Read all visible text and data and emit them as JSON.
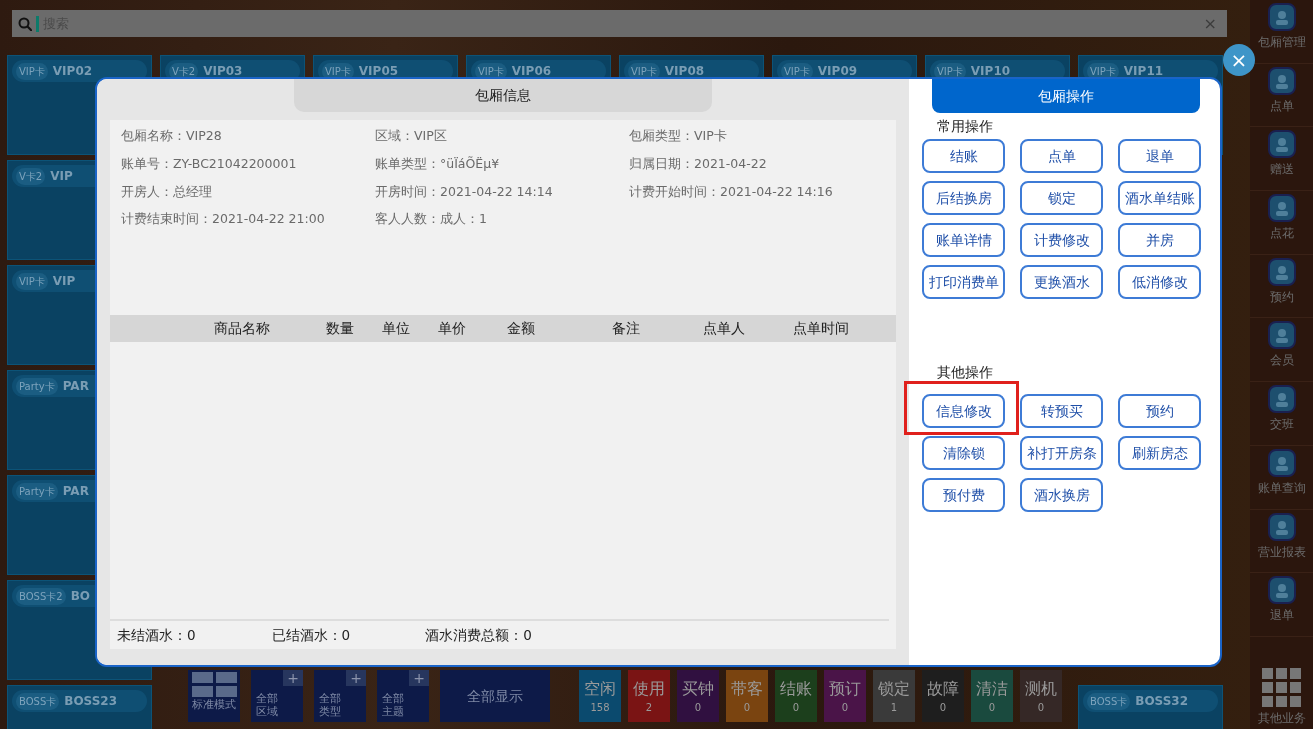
{
  "search": {
    "placeholder": "搜索",
    "clear": "×"
  },
  "rooms": [
    [
      {
        "tag": "VIP卡",
        "name": "VIP02"
      },
      {
        "tag": "V卡2",
        "name": "VIP03"
      },
      {
        "tag": "VIP卡",
        "name": "VIP05"
      },
      {
        "tag": "VIP卡",
        "name": "VIP06"
      },
      {
        "tag": "VIP卡",
        "name": "VIP08"
      },
      {
        "tag": "VIP卡",
        "name": "VIP09"
      },
      {
        "tag": "VIP卡",
        "name": "VIP10"
      },
      {
        "tag": "VIP卡",
        "name": "VIP11"
      }
    ],
    [
      {
        "tag": "V卡2",
        "name": "VIP"
      }
    ],
    [
      {
        "tag": "VIP卡",
        "name": "VIP"
      }
    ],
    [
      {
        "tag": "Party卡",
        "name": "PAR"
      }
    ],
    [
      {
        "tag": "Party卡",
        "name": "PAR"
      }
    ],
    [
      {
        "tag": "BOSS卡2",
        "name": "BO"
      }
    ],
    [
      {
        "tag": "BOSS卡",
        "name": "BOSS23"
      },
      {
        "tag": "BOSS卡",
        "name": "BOSS32"
      }
    ]
  ],
  "sidebar": {
    "items": [
      {
        "label": "包厢管理"
      },
      {
        "label": "点单"
      },
      {
        "label": "赠送"
      },
      {
        "label": "点花"
      },
      {
        "label": "预约"
      },
      {
        "label": "会员"
      },
      {
        "label": "交班"
      },
      {
        "label": "账单查询"
      },
      {
        "label": "营业报表"
      },
      {
        "label": "退单"
      }
    ],
    "more": {
      "label": "其他业务"
    }
  },
  "toolbar": {
    "mode": {
      "label": "标准模式"
    },
    "filters": [
      {
        "label": "全部区域",
        "plus": "+"
      },
      {
        "label": "全部类型",
        "plus": "+"
      },
      {
        "label": "全部主题",
        "plus": "+"
      }
    ],
    "show_all": "全部显示",
    "statuses": [
      {
        "label": "空闲",
        "count": "158",
        "color": "#0b4a6e"
      },
      {
        "label": "使用",
        "count": "2",
        "color": "#7a1414"
      },
      {
        "label": "买钟",
        "count": "0",
        "color": "#301040"
      },
      {
        "label": "带客",
        "count": "0",
        "color": "#7a4410"
      },
      {
        "label": "结账",
        "count": "0",
        "color": "#1c3f1c"
      },
      {
        "label": "预订",
        "count": "0",
        "color": "#4a1448"
      },
      {
        "label": "锁定",
        "count": "1",
        "color": "#3a3a3a"
      },
      {
        "label": "故障",
        "count": "0",
        "color": "#1e1e1e"
      },
      {
        "label": "清洁",
        "count": "0",
        "color": "#1a4a3e"
      },
      {
        "label": "测机",
        "count": "0",
        "color": "#352826"
      }
    ]
  },
  "modal": {
    "close": "×",
    "info_tab": "包厢信息",
    "ops_tab": "包厢操作",
    "fields": [
      "包厢名称：VIP28",
      "区域：VIP区",
      "包厢类型：VIP卡",
      "账单号：ZY-BC21042200001",
      "账单类型：°üÏáÕËµ¥",
      "归属日期：2021-04-22",
      "开房人：总经理",
      "开房时间：2021-04-22 14:14",
      "计费开始时间：2021-04-22 14:16",
      "计费结束时间：2021-04-22 21:00",
      "客人人数：成人：1"
    ],
    "table": {
      "columns": [
        "商品名称",
        "数量",
        "单位",
        "单价",
        "金额",
        "备注",
        "点单人",
        "点单时间"
      ]
    },
    "summary": [
      "未结酒水：0",
      "已结酒水：0",
      "酒水消费总额：0"
    ],
    "sections": [
      {
        "title": "常用操作",
        "buttons": [
          {
            "label": "结账",
            "highlighted": false
          },
          {
            "label": "点单",
            "highlighted": false
          },
          {
            "label": "退单",
            "highlighted": false
          },
          {
            "label": "后结换房",
            "highlighted": false
          },
          {
            "label": "锁定",
            "highlighted": false
          },
          {
            "label": "酒水单结账",
            "highlighted": false
          },
          {
            "label": "账单详情",
            "highlighted": false
          },
          {
            "label": "计费修改",
            "highlighted": false
          },
          {
            "label": "并房",
            "highlighted": false
          },
          {
            "label": "打印消费单",
            "highlighted": false
          },
          {
            "label": "更换酒水",
            "highlighted": false
          },
          {
            "label": "低消修改",
            "highlighted": false
          }
        ]
      },
      {
        "title": "其他操作",
        "buttons": [
          {
            "label": "信息修改",
            "highlighted": true
          },
          {
            "label": "转预买",
            "highlighted": false
          },
          {
            "label": "预约",
            "highlighted": false
          },
          {
            "label": "清除锁",
            "highlighted": false
          },
          {
            "label": "补打开房条",
            "highlighted": false
          },
          {
            "label": "刷新房态",
            "highlighted": false
          },
          {
            "label": "预付费",
            "highlighted": false
          },
          {
            "label": "酒水换房",
            "highlighted": false
          }
        ]
      }
    ]
  }
}
